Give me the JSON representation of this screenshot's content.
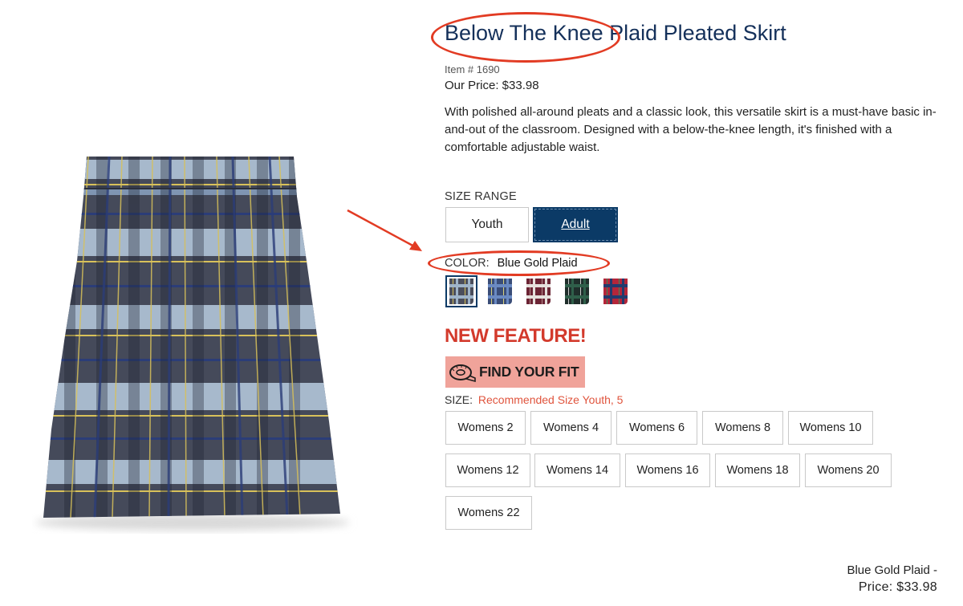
{
  "product": {
    "title": "Below The Knee Plaid Pleated Skirt",
    "item_number": "Item # 1690",
    "price_line": "Our Price: $33.98",
    "description": "With polished all-around pleats and a classic look, this versatile skirt is a must-have basic in-and-out of the classroom. Designed with a below-the-knee length, it's finished with a comfortable adjustable waist."
  },
  "size_range": {
    "label": "SIZE RANGE",
    "options": [
      "Youth",
      "Adult"
    ],
    "selected": "Adult"
  },
  "color": {
    "label": "COLOR:",
    "value": "Blue Gold Plaid",
    "swatches": [
      {
        "name": "Blue Gold Plaid",
        "base": "#4b4e5c",
        "stripe": "#9fb4c9",
        "accent": "#d6c15a",
        "selected": true
      },
      {
        "name": "Blue Plaid",
        "base": "#3a4d78",
        "stripe": "#6a8ac2",
        "accent": "#d8d27a",
        "selected": false
      },
      {
        "name": "Burgundy Plaid",
        "base": "#6b2434",
        "stripe": "#e6e0dc",
        "accent": "#b88d8d",
        "selected": false
      },
      {
        "name": "Green Plaid",
        "base": "#1f2e2b",
        "stripe": "#2f5f4a",
        "accent": "#c9c9c9",
        "selected": false
      },
      {
        "name": "Red Plaid",
        "base": "#b4263a",
        "stripe": "#233a6e",
        "accent": "#3b8a5a",
        "selected": false
      }
    ]
  },
  "fit": {
    "new_feature": "NEW FEATURE!",
    "button_label": "FIND YOUR FIT"
  },
  "size": {
    "label": "SIZE:",
    "recommendation": "Recommended Size Youth, 5",
    "options": [
      "Womens 2",
      "Womens 4",
      "Womens 6",
      "Womens 8",
      "Womens 10",
      "Womens 12",
      "Womens 14",
      "Womens 16",
      "Womens 18",
      "Womens 20",
      "Womens 22"
    ]
  },
  "summary": {
    "color_line": "Blue Gold Plaid -",
    "price_line": "Price: $33.98"
  },
  "colors": {
    "title": "#14305a",
    "adult_selected": "#0b3a66",
    "highlight": "#e23b23",
    "new_feature": "#d33a2c",
    "fit_button": "#f0a39a",
    "recommendation": "#e0543d"
  }
}
